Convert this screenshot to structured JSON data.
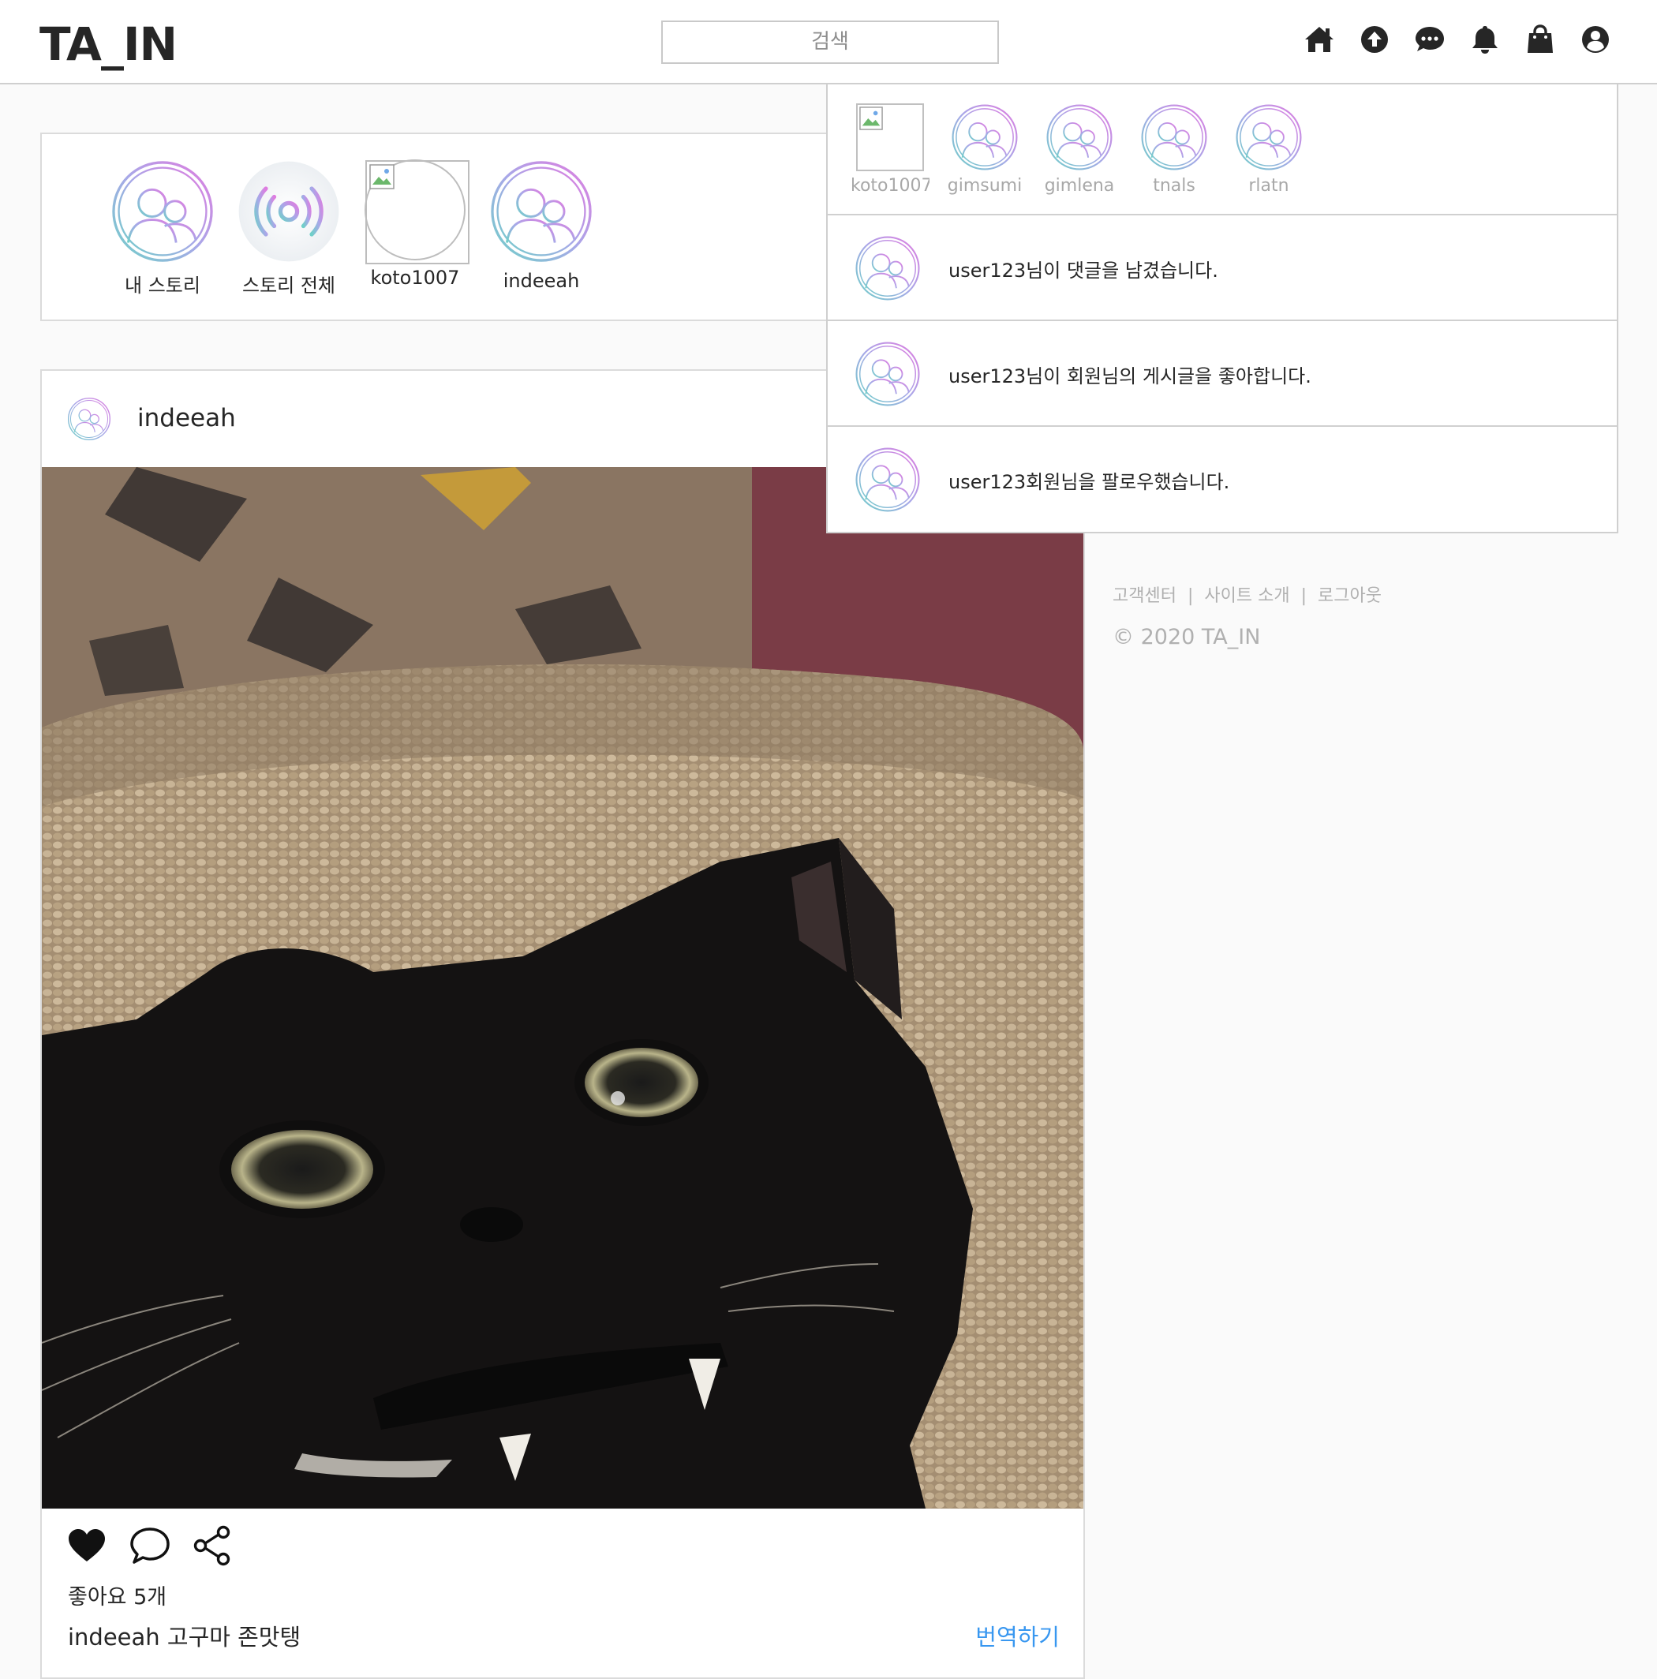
{
  "header": {
    "logo": "TA_IN",
    "search_placeholder": "검색",
    "icons": [
      "home-icon",
      "upload-icon",
      "chat-icon",
      "bell-icon",
      "shopping-bag-icon",
      "account-icon"
    ]
  },
  "stories": [
    {
      "label": "내 스토리",
      "type": "avatar"
    },
    {
      "label": "스토리 전체",
      "type": "broadcast"
    },
    {
      "label": "koto1007",
      "type": "broken"
    },
    {
      "label": "indeeah",
      "type": "avatar"
    }
  ],
  "post": {
    "username": "indeeah",
    "likes": "좋아요 5개",
    "caption": "indeeah 고구마 존맛탱",
    "translate": "번역하기"
  },
  "footer": {
    "links": [
      "고객센터",
      "사이트 소개",
      "로그아웃"
    ],
    "separator": "|",
    "copyright": "© 2020 TA_IN"
  },
  "notifications": {
    "stories": [
      "koto1007",
      "gimsumi",
      "gimlena",
      "tnals",
      "rlatn"
    ],
    "items": [
      "user123님이 댓글을 남겼습니다.",
      "user123님이 회원님의 게시글을 좋아합니다.",
      "user123회원님을 팔로우했습니다."
    ]
  },
  "colors": {
    "ring_gradient_start": "#e07be0",
    "ring_gradient_end": "#6fd0c8",
    "link_blue": "#3897f0"
  }
}
